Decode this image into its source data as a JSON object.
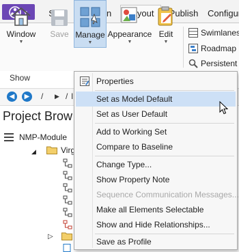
{
  "tabs": [
    {
      "label": "Start",
      "active": false
    },
    {
      "label": "Design",
      "active": false
    },
    {
      "label": "Layout",
      "active": true
    },
    {
      "label": "Publish",
      "active": false
    },
    {
      "label": "Configure",
      "active": false
    }
  ],
  "ribbon": {
    "window": {
      "label": "Window"
    },
    "save": {
      "label": "Save"
    },
    "manage": {
      "label": "Manage"
    },
    "appearance": {
      "label": "Appearance"
    },
    "edit": {
      "label": "Edit"
    },
    "small_buttons": [
      {
        "label": "Swimlanes"
      },
      {
        "label": "Roadmap"
      },
      {
        "label": "Persistent Z"
      }
    ],
    "group_show": "Show"
  },
  "navbar": {
    "slash1": "/",
    "slash2": "/",
    "trail": "I"
  },
  "project_browser": {
    "title": "Project Brow",
    "root": "NMP-Module",
    "child": "Virgi"
  },
  "menu": {
    "items": [
      {
        "label": "Properties",
        "highlighted": false,
        "disabled": false
      },
      {
        "label": "Set as Model Default",
        "highlighted": true,
        "disabled": false
      },
      {
        "label": "Set as User Default",
        "highlighted": false,
        "disabled": false
      },
      {
        "label": "Add to Working Set",
        "highlighted": false,
        "disabled": false
      },
      {
        "label": "Compare to Baseline",
        "highlighted": false,
        "disabled": false
      },
      {
        "label": "Change Type...",
        "highlighted": false,
        "disabled": false
      },
      {
        "label": "Show Property Note",
        "highlighted": false,
        "disabled": false
      },
      {
        "label": "Sequence Communication Messages...",
        "highlighted": false,
        "disabled": true
      },
      {
        "label": "Make all Elements Selectable",
        "highlighted": false,
        "disabled": false
      },
      {
        "label": "Show and Hide Relationships...",
        "highlighted": false,
        "disabled": false
      },
      {
        "label": "Save as Profile",
        "highlighted": false,
        "disabled": false
      }
    ]
  },
  "colors": {
    "app_button": "#6b46b5",
    "accent": "#1f78c8",
    "menu_highlight": "#cde0f6",
    "pressed_button": "#c9ddf2"
  }
}
